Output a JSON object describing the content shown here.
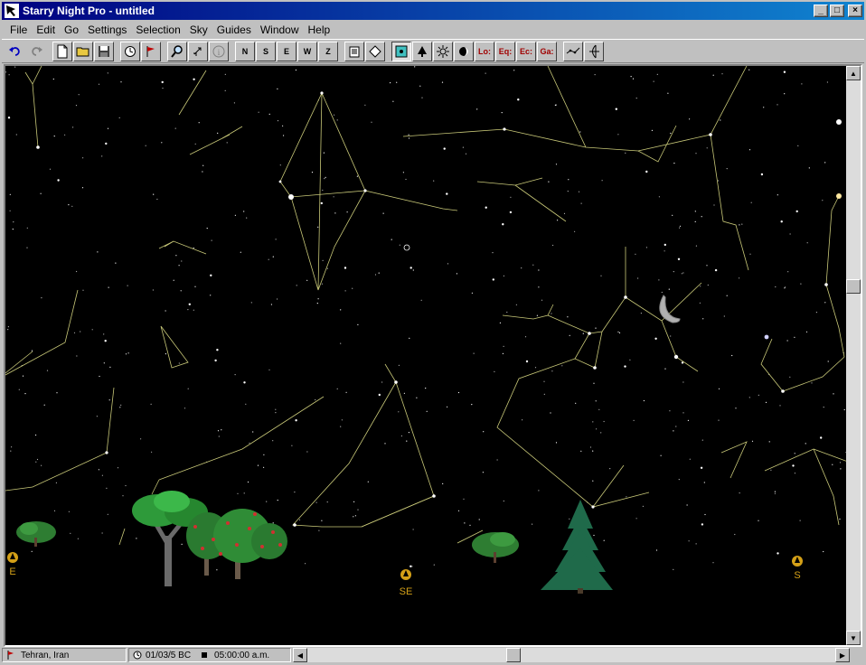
{
  "window": {
    "title": "Starry Night Pro - untitled",
    "minimize": "_",
    "maximize": "□",
    "close": "×"
  },
  "menu": {
    "items": [
      "File",
      "Edit",
      "Go",
      "Settings",
      "Selection",
      "Sky",
      "Guides",
      "Window",
      "Help"
    ]
  },
  "toolbar": {
    "north": "N",
    "south": "S",
    "east": "E",
    "west": "W",
    "zenith": "Z",
    "local": "Lo:",
    "equatorial": "Eq:",
    "ecliptic": "Ec:",
    "galactic": "Ga:"
  },
  "horizon": {
    "east": "E",
    "southeast": "SE",
    "south": "S"
  },
  "status": {
    "location": "Tehran, Iran",
    "date": "01/03/5 BC",
    "time": "05:00:00 a.m."
  },
  "colors": {
    "sky": "#000000",
    "constellation_lines": "#c8c878",
    "compass_label": "#d4a017",
    "title_gradient_start": "#000080"
  }
}
